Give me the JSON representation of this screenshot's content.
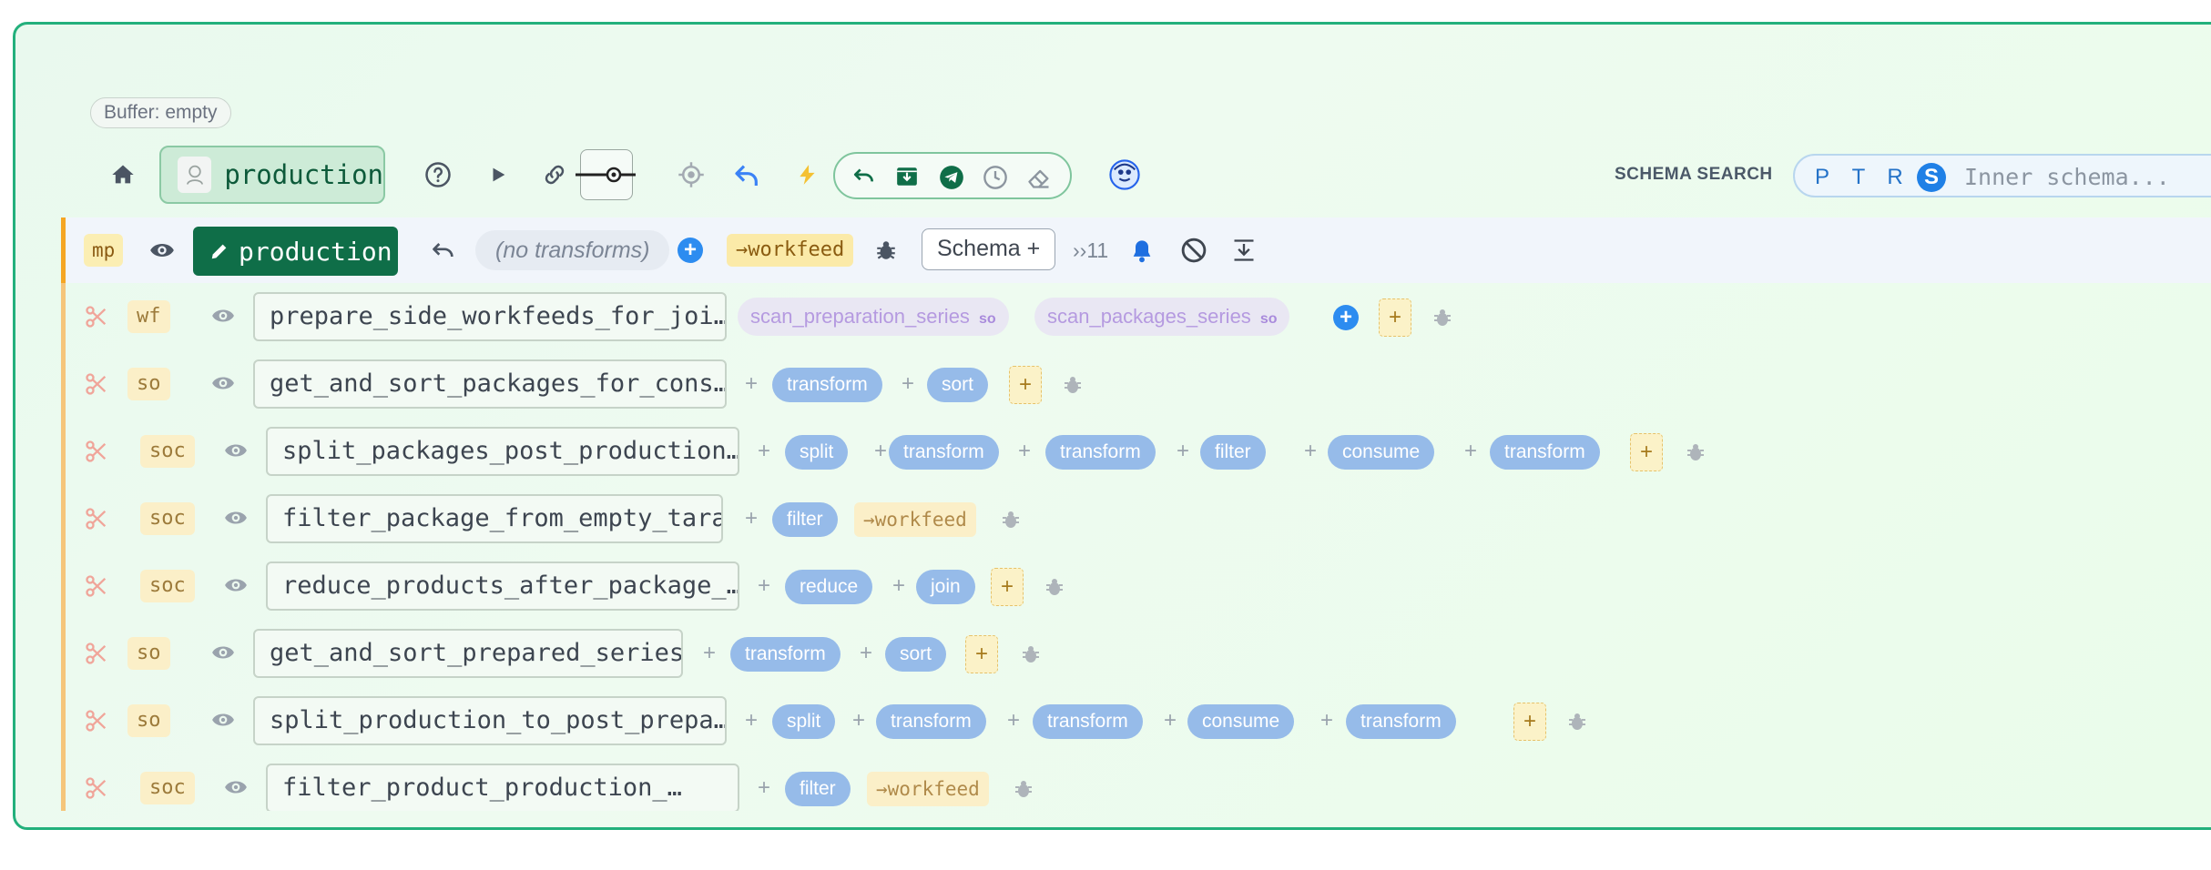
{
  "buffer_label": "Buffer: empty",
  "toolbar": {
    "project_name": "production",
    "schema_search_label": "SCHEMA SEARCH",
    "search_keys": [
      "P",
      "T",
      "R",
      "S"
    ],
    "search_selected": "S",
    "search_placeholder": "Inner schema..."
  },
  "main_row": {
    "tag": "mp",
    "name": "production",
    "transforms_text": "(no transforms)",
    "workfeed_tag": "→workfeed",
    "schema_button": "Schema +",
    "more_count": "››11"
  },
  "rows": [
    {
      "kind": "wf",
      "name": "prepare_side_workfeeds_for_joi…",
      "steps": [],
      "series": [
        {
          "label": "scan_preparation_series",
          "tag": "so"
        },
        {
          "label": "scan_packages_series",
          "tag": "so"
        }
      ]
    },
    {
      "kind": "so",
      "name": "get_and_sort_packages_for_cons…",
      "steps": [
        "transform",
        "sort"
      ]
    },
    {
      "kind": "soc",
      "name": "split_packages_post_production…",
      "steps": [
        "split",
        "transform",
        "transform",
        "filter",
        "consume",
        "transform"
      ]
    },
    {
      "kind": "soc",
      "name": "filter_package_from_empty_tara",
      "steps": [
        "filter"
      ],
      "workfeed": "→workfeed"
    },
    {
      "kind": "soc",
      "name": "reduce_products_after_package_…",
      "steps": [
        "reduce",
        "join"
      ]
    },
    {
      "kind": "so",
      "name": "get_and_sort_prepared_series",
      "steps": [
        "transform",
        "sort"
      ]
    },
    {
      "kind": "so",
      "name": "split_production_to_post_prepa…",
      "steps": [
        "split",
        "transform",
        "transform",
        "consume",
        "transform"
      ]
    },
    {
      "kind": "soc",
      "name": "filter_product_production_…",
      "steps": [
        "filter"
      ],
      "workfeed": "→workfeed"
    }
  ]
}
